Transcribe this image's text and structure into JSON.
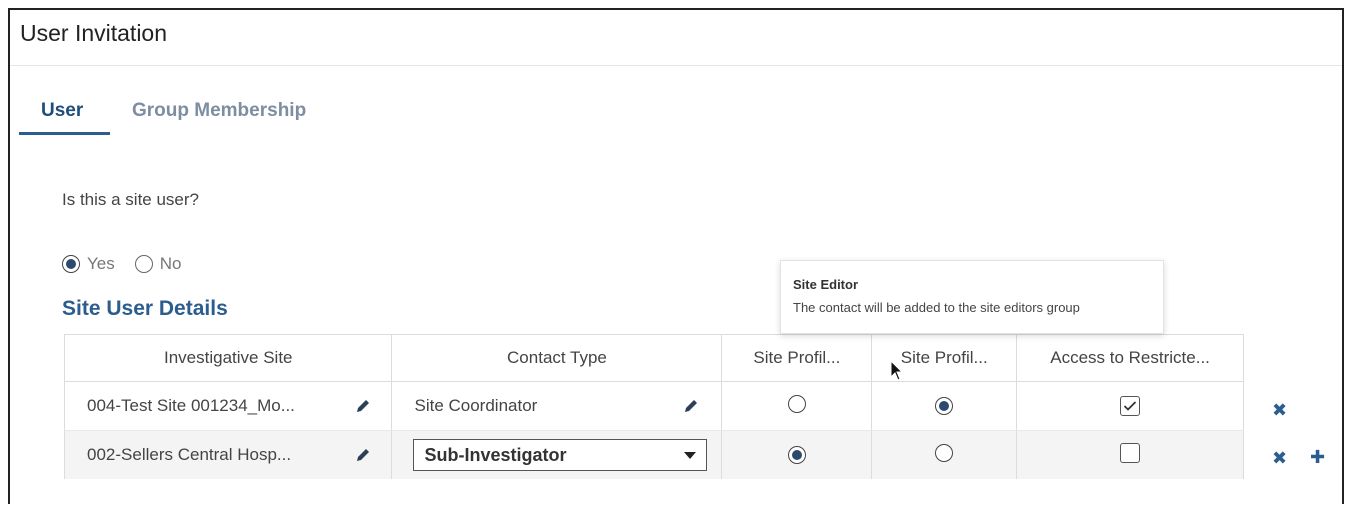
{
  "window": {
    "title": "User Invitation"
  },
  "tabs": [
    {
      "label": "User",
      "active": true
    },
    {
      "label": "Group Membership",
      "active": false
    }
  ],
  "question": "Is this a site user?",
  "site_user_options": [
    {
      "label": "Yes",
      "selected": true
    },
    {
      "label": "No",
      "selected": false
    }
  ],
  "section_title": "Site User Details",
  "table": {
    "headers": [
      "Investigative Site",
      "Contact Type",
      "Site Profil...",
      "Site Profil...",
      "Access to Restricte..."
    ],
    "rows": [
      {
        "site": "004-Test Site 001234_Mo...",
        "contact_type": "Site Coordinator",
        "profile_1": false,
        "profile_2": true,
        "restricted_access": true
      },
      {
        "site": "002-Sellers Central Hosp...",
        "contact_type": "Sub-Investigator",
        "profile_1": true,
        "profile_2": false,
        "restricted_access": false
      }
    ]
  },
  "tooltip": {
    "title": "Site Editor",
    "body": "The contact will be added to the site editors group"
  },
  "icons": {
    "edit": "pencil-icon",
    "remove": "close-icon",
    "add": "plus-icon",
    "remove_glyph": "✖",
    "add_glyph": "✚"
  },
  "colors": {
    "accent": "#2c5d8f",
    "active_tab": "#1f4e79",
    "inactive_tab": "#7d8da2"
  }
}
